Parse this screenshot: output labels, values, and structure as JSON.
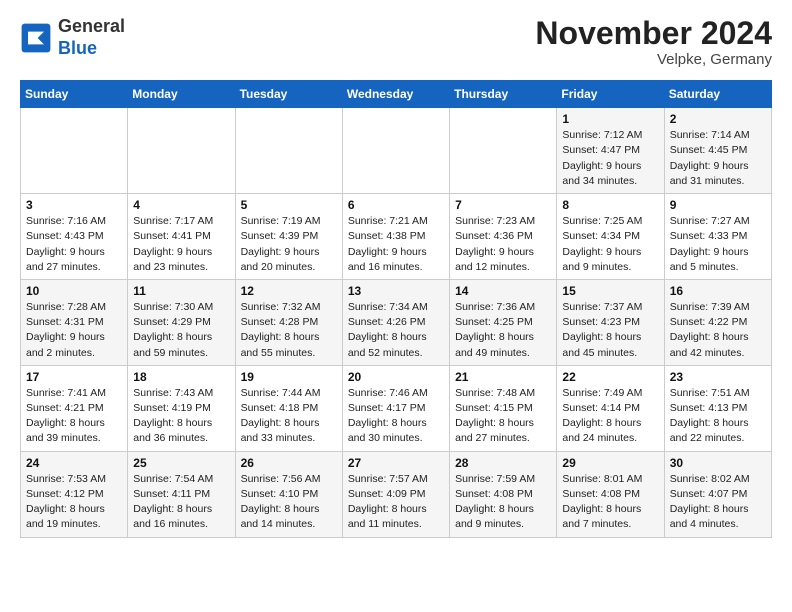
{
  "logo": {
    "text_general": "General",
    "text_blue": "Blue"
  },
  "header": {
    "month_title": "November 2024",
    "location": "Velpke, Germany"
  },
  "weekdays": [
    "Sunday",
    "Monday",
    "Tuesday",
    "Wednesday",
    "Thursday",
    "Friday",
    "Saturday"
  ],
  "weeks": [
    [
      {
        "day": "",
        "info": ""
      },
      {
        "day": "",
        "info": ""
      },
      {
        "day": "",
        "info": ""
      },
      {
        "day": "",
        "info": ""
      },
      {
        "day": "",
        "info": ""
      },
      {
        "day": "1",
        "info": "Sunrise: 7:12 AM\nSunset: 4:47 PM\nDaylight: 9 hours and 34 minutes."
      },
      {
        "day": "2",
        "info": "Sunrise: 7:14 AM\nSunset: 4:45 PM\nDaylight: 9 hours and 31 minutes."
      }
    ],
    [
      {
        "day": "3",
        "info": "Sunrise: 7:16 AM\nSunset: 4:43 PM\nDaylight: 9 hours and 27 minutes."
      },
      {
        "day": "4",
        "info": "Sunrise: 7:17 AM\nSunset: 4:41 PM\nDaylight: 9 hours and 23 minutes."
      },
      {
        "day": "5",
        "info": "Sunrise: 7:19 AM\nSunset: 4:39 PM\nDaylight: 9 hours and 20 minutes."
      },
      {
        "day": "6",
        "info": "Sunrise: 7:21 AM\nSunset: 4:38 PM\nDaylight: 9 hours and 16 minutes."
      },
      {
        "day": "7",
        "info": "Sunrise: 7:23 AM\nSunset: 4:36 PM\nDaylight: 9 hours and 12 minutes."
      },
      {
        "day": "8",
        "info": "Sunrise: 7:25 AM\nSunset: 4:34 PM\nDaylight: 9 hours and 9 minutes."
      },
      {
        "day": "9",
        "info": "Sunrise: 7:27 AM\nSunset: 4:33 PM\nDaylight: 9 hours and 5 minutes."
      }
    ],
    [
      {
        "day": "10",
        "info": "Sunrise: 7:28 AM\nSunset: 4:31 PM\nDaylight: 9 hours and 2 minutes."
      },
      {
        "day": "11",
        "info": "Sunrise: 7:30 AM\nSunset: 4:29 PM\nDaylight: 8 hours and 59 minutes."
      },
      {
        "day": "12",
        "info": "Sunrise: 7:32 AM\nSunset: 4:28 PM\nDaylight: 8 hours and 55 minutes."
      },
      {
        "day": "13",
        "info": "Sunrise: 7:34 AM\nSunset: 4:26 PM\nDaylight: 8 hours and 52 minutes."
      },
      {
        "day": "14",
        "info": "Sunrise: 7:36 AM\nSunset: 4:25 PM\nDaylight: 8 hours and 49 minutes."
      },
      {
        "day": "15",
        "info": "Sunrise: 7:37 AM\nSunset: 4:23 PM\nDaylight: 8 hours and 45 minutes."
      },
      {
        "day": "16",
        "info": "Sunrise: 7:39 AM\nSunset: 4:22 PM\nDaylight: 8 hours and 42 minutes."
      }
    ],
    [
      {
        "day": "17",
        "info": "Sunrise: 7:41 AM\nSunset: 4:21 PM\nDaylight: 8 hours and 39 minutes."
      },
      {
        "day": "18",
        "info": "Sunrise: 7:43 AM\nSunset: 4:19 PM\nDaylight: 8 hours and 36 minutes."
      },
      {
        "day": "19",
        "info": "Sunrise: 7:44 AM\nSunset: 4:18 PM\nDaylight: 8 hours and 33 minutes."
      },
      {
        "day": "20",
        "info": "Sunrise: 7:46 AM\nSunset: 4:17 PM\nDaylight: 8 hours and 30 minutes."
      },
      {
        "day": "21",
        "info": "Sunrise: 7:48 AM\nSunset: 4:15 PM\nDaylight: 8 hours and 27 minutes."
      },
      {
        "day": "22",
        "info": "Sunrise: 7:49 AM\nSunset: 4:14 PM\nDaylight: 8 hours and 24 minutes."
      },
      {
        "day": "23",
        "info": "Sunrise: 7:51 AM\nSunset: 4:13 PM\nDaylight: 8 hours and 22 minutes."
      }
    ],
    [
      {
        "day": "24",
        "info": "Sunrise: 7:53 AM\nSunset: 4:12 PM\nDaylight: 8 hours and 19 minutes."
      },
      {
        "day": "25",
        "info": "Sunrise: 7:54 AM\nSunset: 4:11 PM\nDaylight: 8 hours and 16 minutes."
      },
      {
        "day": "26",
        "info": "Sunrise: 7:56 AM\nSunset: 4:10 PM\nDaylight: 8 hours and 14 minutes."
      },
      {
        "day": "27",
        "info": "Sunrise: 7:57 AM\nSunset: 4:09 PM\nDaylight: 8 hours and 11 minutes."
      },
      {
        "day": "28",
        "info": "Sunrise: 7:59 AM\nSunset: 4:08 PM\nDaylight: 8 hours and 9 minutes."
      },
      {
        "day": "29",
        "info": "Sunrise: 8:01 AM\nSunset: 4:08 PM\nDaylight: 8 hours and 7 minutes."
      },
      {
        "day": "30",
        "info": "Sunrise: 8:02 AM\nSunset: 4:07 PM\nDaylight: 8 hours and 4 minutes."
      }
    ]
  ]
}
